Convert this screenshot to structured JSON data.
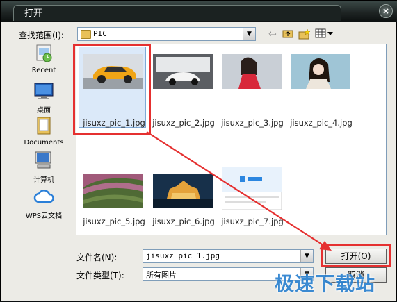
{
  "window": {
    "title": "打开",
    "close_symbol": "×"
  },
  "lookin": {
    "label": "查找范围(I):",
    "value": "PIC"
  },
  "toolbar": {
    "back_icon": "back-arrow-icon",
    "up_icon": "up-folder-icon",
    "new_folder_icon": "new-folder-icon",
    "views_icon": "views-menu-icon"
  },
  "places": [
    {
      "label": "Recent",
      "icon": "recent-icon"
    },
    {
      "label": "桌面",
      "icon": "desktop-icon"
    },
    {
      "label": "Documents",
      "icon": "documents-icon"
    },
    {
      "label": "计算机",
      "icon": "computer-icon"
    },
    {
      "label": "WPS云文档",
      "icon": "cloud-icon"
    }
  ],
  "files": [
    {
      "name": "jisuxz_pic_1.jpg",
      "selected": true
    },
    {
      "name": "jisuxz_pic_2.jpg"
    },
    {
      "name": "jisuxz_pic_3.jpg"
    },
    {
      "name": "jisuxz_pic_4.jpg"
    },
    {
      "name": "jisuxz_pic_5.jpg"
    },
    {
      "name": "jisuxz_pic_6.jpg"
    },
    {
      "name": "jisuxz_pic_7.jpg"
    }
  ],
  "filename": {
    "label": "文件名(N):",
    "value": "jisuxz_pic_1.jpg"
  },
  "filetype": {
    "label": "文件类型(T):",
    "value": "所有图片"
  },
  "buttons": {
    "open": "打开(O)",
    "cancel": "取消"
  },
  "watermark": "极速下载站",
  "accent": {
    "highlight": "#e53030",
    "selection": "#dbe9f9"
  }
}
